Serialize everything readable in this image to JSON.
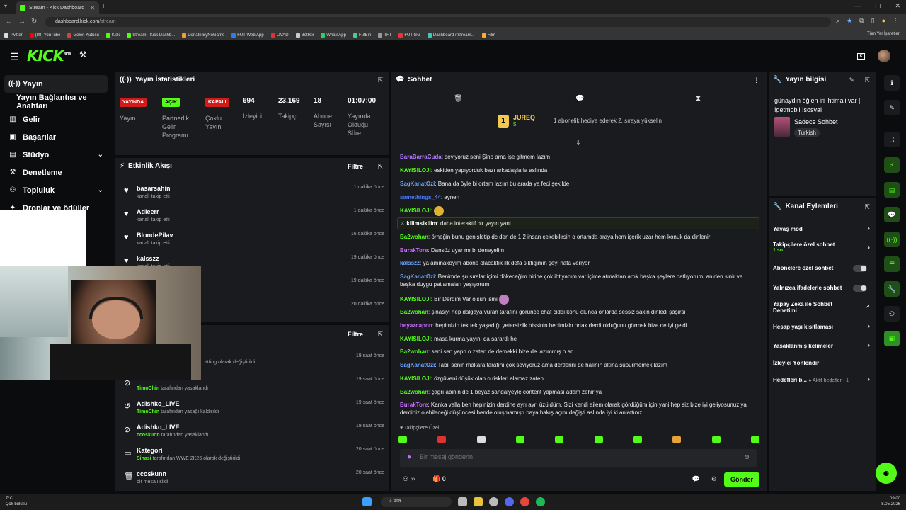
{
  "browser": {
    "tab_title": "Stream - Kick Dashboard",
    "url_host": "dashboard.kick.com",
    "url_path": "/stream",
    "bookmarks": [
      "Twitter",
      "(88) YouTube",
      "Gelen Kutusu",
      "Kick",
      "Stream - Kick Dashb...",
      "Donate ByNoGame",
      "FUT Web App",
      "LIVAD",
      "BotRix",
      "WhatsApp",
      "FutBin",
      "TFT",
      "FUT GG",
      "Dashboard / Stream...",
      "Film"
    ],
    "bookmarks_right": "Tüm Yer İşaretleri"
  },
  "header": {
    "logo": "KICK",
    "logo_badge": "BETA"
  },
  "sidebar": {
    "items": [
      {
        "label": "Yayın",
        "icon": "broadcast-icon"
      },
      {
        "label": "Yayın Bağlantısı ve Anahtarı",
        "icon": "key-icon"
      },
      {
        "label": "Gelir",
        "icon": "bank-icon"
      },
      {
        "label": "Başarılar",
        "icon": "trophy-icon"
      },
      {
        "label": "Stüdyo",
        "icon": "studio-icon"
      },
      {
        "label": "Denetleme",
        "icon": "hammer-icon"
      },
      {
        "label": "Topluluk",
        "icon": "community-icon"
      },
      {
        "label": "Droplar ve ödüller",
        "icon": "gift-icon"
      }
    ]
  },
  "stats": {
    "title": "Yayın İstatistikleri",
    "items": [
      {
        "badge": "YAYINDA",
        "label": "Yayın",
        "badge_color": "#d11a1a"
      },
      {
        "badge": "AÇIK",
        "label": "Partnerlik Gelir Programı",
        "badge_color": "#53fc18"
      },
      {
        "badge": "KAPALI",
        "label": "Çoklu Yayın",
        "badge_color": "#d11a1a"
      },
      {
        "value": "694",
        "label": "İzleyici"
      },
      {
        "value": "23.169",
        "label": "Takipçi"
      },
      {
        "value": "18",
        "label": "Abone Sayısı"
      },
      {
        "value": "01:07:00",
        "label": "Yayında Olduğu Süre"
      }
    ]
  },
  "activity": {
    "title": "Etkinlik Akışı",
    "filter": "Filtre",
    "items": [
      {
        "name": "basarsahin",
        "sub": "kanalı takip etti",
        "time": "1 dakika önce"
      },
      {
        "name": "Adleerr",
        "sub": "kanalı takip etti",
        "time": "1 dakika önce"
      },
      {
        "name": "BlondePilav",
        "sub": "kanalı takip etti",
        "time": "16 dakika önce"
      },
      {
        "name": "kalsszz",
        "sub": "kanalı takip etti",
        "time": "19 dakika önce"
      },
      {
        "name": "",
        "sub": "",
        "time": "19 dakika önce"
      },
      {
        "name": "",
        "sub": "",
        "time": "20 dakika önce"
      }
    ]
  },
  "mod_log": {
    "filter": "Filtre",
    "items": [
      {
        "name": "",
        "user": "",
        "action": "atting olarak değiştirildi",
        "time": "19 saat önce"
      },
      {
        "name": "",
        "user": "TimoChin",
        "action": "tarafından yasaklandı",
        "time": "19 saat önce"
      },
      {
        "name": "Adishko_LIVE",
        "user": "TimoChin",
        "action": "tarafından yasağı kaldırıldı",
        "time": "19 saat önce"
      },
      {
        "name": "Adishko_LIVE",
        "user": "ccoskunn",
        "action": "tarafından yasaklandı",
        "time": "19 saat önce"
      },
      {
        "name": "Kategori",
        "user": "Sinasi",
        "action": "tarafından WWE 2K26 olarak değiştirildi",
        "time": "20 saat önce"
      },
      {
        "name": "ccoskunn",
        "user": "",
        "action": "bir mesajı sildi",
        "time": "20 saat önce"
      }
    ]
  },
  "chat": {
    "title": "Sohbet",
    "pinned_user": "JUREQ",
    "pinned_rank": "1",
    "pinned_count": "5",
    "pinned_text": "1 abonelik hediye ederek 2. sıraya yükselin",
    "messages": [
      {
        "user": "BaraBarraCuda",
        "color": "#b07bff",
        "text": ": seviyoruz seni Şino ama işe gitmem lazım"
      },
      {
        "user": "KAYISILOJI",
        "color": "#53fc18",
        "text": ": eskiden yapıyorduk bazı arkadaşlarla aslında"
      },
      {
        "user": "SagKanatOzi",
        "color": "#6ea6ff",
        "text": ": Bana da öyle bi ortam lazım bu arada ya feci şekilde"
      },
      {
        "user": "samethings_44",
        "color": "#4a7dff",
        "text": ": aynen"
      },
      {
        "user": "KAYISILOJI",
        "color": "#53fc18",
        "text": ":"
      },
      {
        "user": "kilimsikilim",
        "color": "#ffffff",
        "text": ": daha interaktif bir yayın yani"
      },
      {
        "user": "Ba2wohan",
        "color": "#53fc18",
        "text": ": örneğin bunu genişletip dc den de 1 2 insan çekebilirsin o ortamda araya hem içerik uzar hem konuk da dinlenir"
      },
      {
        "user": "BurakTore",
        "color": "#c86bff",
        "text": ": Dansöz uyar mı bi deneyelim"
      },
      {
        "user": "kalsszz",
        "color": "#6ea6ff",
        "text": ": ya amınakoyım abone olacaktık ilk defa siktiğimin şeyi hata veriyor"
      },
      {
        "user": "SagKanatOzi",
        "color": "#6ea6ff",
        "text": ": Benimde şu sıralar içimi dökeceğim birine çok ihtiyacım var içime atmaktan artık başka şeylere patlıyorum, aniden sinir ve başka duygu patlamaları yaşıyorum"
      },
      {
        "user": "KAYISILOJI",
        "color": "#53fc18",
        "text": ": Bir Derdim Var olsun ismi"
      },
      {
        "user": "Ba2wohan",
        "color": "#53fc18",
        "text": ": şinasiyi hep dalgaya vuran tarafını görünce chat ciddi konu olunca onlarda sessiz sakin dinledi şaşırsı"
      },
      {
        "user": "beyazcapon",
        "color": "#c86bff",
        "text": ": hepimizin tek tek yaşadığı yetersizlik hissinin hepimizin ortak derdi olduğunu görmek bize de iyi geldi"
      },
      {
        "user": "KAYISILOJI",
        "color": "#53fc18",
        "text": ": masa kurma yayını da sarardı he"
      },
      {
        "user": "Ba2wohan",
        "color": "#53fc18",
        "text": ": seni sen yapn o zaten de demekki bize de lazımmış o an"
      },
      {
        "user": "SagKanatOzi",
        "color": "#6ea6ff",
        "text": ": Tabii senin makara tarafını çok seviyoruz ama dertlerini de halının altına süpürmemek lazım"
      },
      {
        "user": "KAYISILOJI",
        "color": "#53fc18",
        "text": ": özgüveni düşük olan o riskleri alamaz zaten"
      },
      {
        "user": "Ba2wohan",
        "color": "#53fc18",
        "text": ": çağrı abinin de 1 beyaz sandalyeyle content yapması adam zehir ya"
      },
      {
        "user": "BurakTore",
        "color": "#c86bff",
        "text": ": Kanka valla ben hepinizin derdine ayrı ayrı üzüldüm. Sizi kendi ailem olarak gördüğüm için yani hep siz bize iyi geliyosunuz ya derdiniz olabileceği düşüncesi bende oluşmamıştı baya bakış açım değişti aslında iyi ki anlattınız"
      }
    ],
    "followers_only": "Takipçilere Özel",
    "input_placeholder": "Bir mesaj gönderin",
    "send_label": "Gönder",
    "viewer_count_bottom": "0"
  },
  "stream_info": {
    "title": "Yayın bilgisi",
    "stream_title": "günaydın öğlen iri ihtimali var | !getmobil !sosyal",
    "category": "Sadece Sohbet",
    "tag": "Turkish"
  },
  "channel_actions": {
    "title": "Kanal Eylemleri",
    "items": [
      {
        "label": "Yavaş mod",
        "kind": "chevron"
      },
      {
        "label": "Takipçilere özel sohbet",
        "sub": "1 sn.",
        "kind": "chevron"
      },
      {
        "label": "Abonelere özel sohbet",
        "kind": "toggle"
      },
      {
        "label": "Yalnızca ifadelerle sohbet",
        "kind": "toggle"
      },
      {
        "label": "Yapay Zeka ile Sohbet Denetimi",
        "kind": "link"
      },
      {
        "label": "Hesap yaşı kısıtlaması",
        "kind": "chevron"
      },
      {
        "label": "Yasaklanmış kelimeler",
        "kind": "chevron"
      },
      {
        "label": "İzleyici Yönlendir",
        "kind": "none"
      },
      {
        "label": "Hedefleri b...",
        "sub": "Aktif hedefler · 1",
        "kind": "chevron"
      }
    ]
  },
  "taskbar": {
    "weather_temp": "7°C",
    "weather_desc": "Çok bulutlu",
    "search": "Ara",
    "time": "09:00",
    "date": "8.05.2026"
  },
  "colors": {
    "accent": "#53fc18",
    "panel": "#191b1f",
    "live_badge": "#d11a1a"
  }
}
